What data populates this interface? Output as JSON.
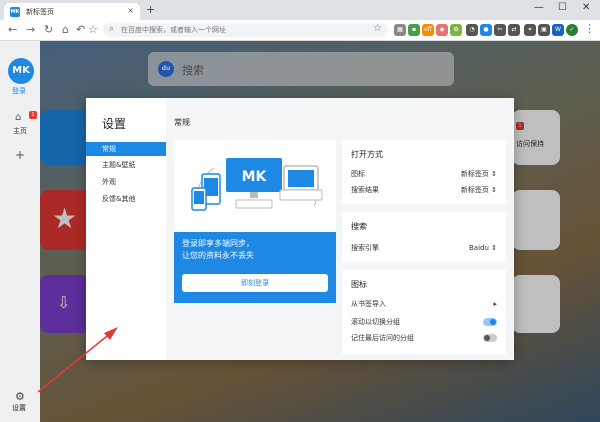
{
  "browser": {
    "tab_title": "新标签页",
    "tab_close": "×",
    "new_tab": "+",
    "win_min": "—",
    "win_max": "☐",
    "win_close": "✕",
    "address_placeholder": "在百度中搜索，或者输入一个网址"
  },
  "sidebar": {
    "avatar_text": "MK",
    "login_label": "登录",
    "home_label": "主页",
    "home_badge": "1",
    "add_label": "+",
    "settings_label": "设置"
  },
  "search": {
    "engine_icon_text": "du",
    "placeholder": "搜索"
  },
  "modal": {
    "title": "设置",
    "close_label": "×",
    "menu": [
      {
        "label": "常规",
        "active": true
      },
      {
        "label": "主题&壁纸",
        "active": false
      },
      {
        "label": "外观",
        "active": false
      },
      {
        "label": "反馈&其他",
        "active": false
      }
    ],
    "section_title": "常规",
    "promo": {
      "logo": "MK",
      "line1": "登录即享多端同步，",
      "line2": "让您的资料永不丢失",
      "button": "即刻登录"
    },
    "open_card": {
      "title": "打开方式",
      "rows": [
        {
          "label": "图标",
          "value": "新标签页"
        },
        {
          "label": "搜索结果",
          "value": "新标签页"
        }
      ]
    },
    "search_card": {
      "title": "搜索",
      "engine_label": "搜索引擎",
      "engine_value": "Baidu"
    },
    "icon_card": {
      "title": "图标",
      "import_label": "从书签导入",
      "scroll_label": "滚动以切换分组",
      "scroll_on": true,
      "remember_label": "记住最后访问的分组",
      "remember_on": false
    }
  },
  "background": {
    "hint_badge": "1",
    "hint_text": "访问保持"
  },
  "colors": {
    "accent": "#1e88e5",
    "badge": "#e53935"
  }
}
